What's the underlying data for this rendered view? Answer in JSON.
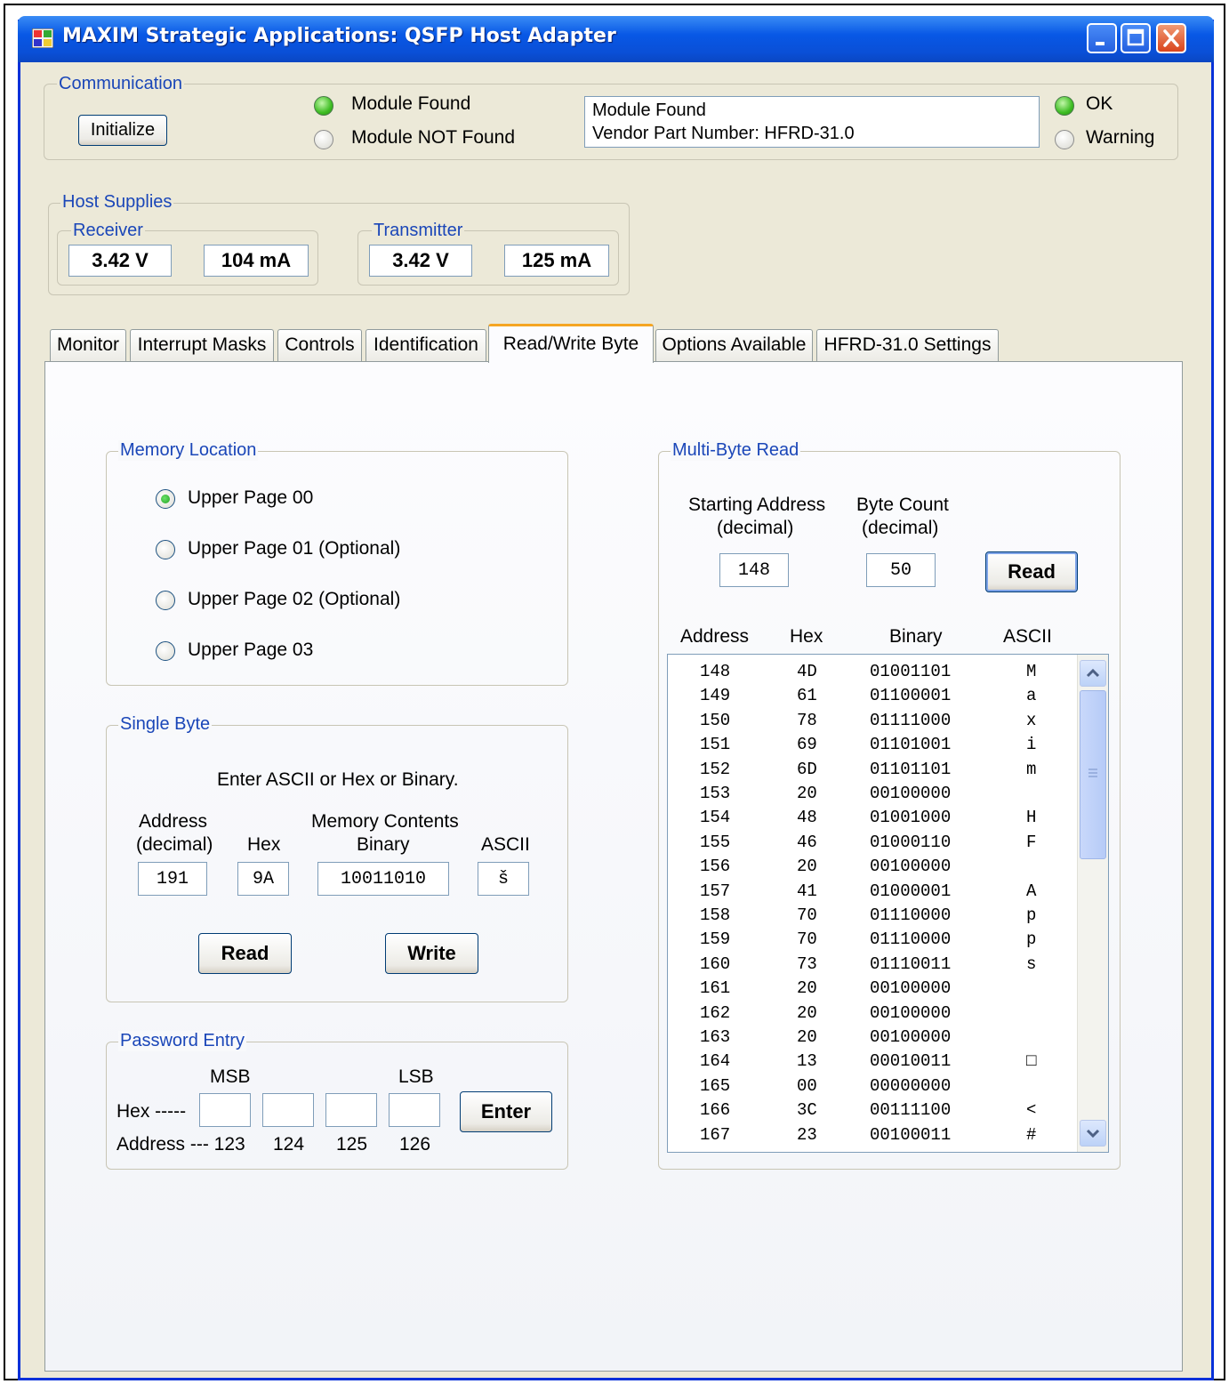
{
  "window": {
    "title": "MAXIM Strategic Applications: QSFP Host Adapter"
  },
  "communication": {
    "legend": "Communication",
    "initialize_label": "Initialize",
    "module_found_label": "Module Found",
    "module_not_found_label": "Module NOT Found",
    "status_line1": "Module Found",
    "status_line2": "Vendor Part Number: HFRD-31.0",
    "ok_label": "OK",
    "warning_label": "Warning"
  },
  "host_supplies": {
    "legend": "Host Supplies",
    "receiver": {
      "legend": "Receiver",
      "voltage": "3.42 V",
      "current": "104 mA"
    },
    "transmitter": {
      "legend": "Transmitter",
      "voltage": "3.42 V",
      "current": "125 mA"
    }
  },
  "tabs": [
    {
      "label": "Monitor"
    },
    {
      "label": "Interrupt Masks"
    },
    {
      "label": "Controls"
    },
    {
      "label": "Identification"
    },
    {
      "label": "Read/Write Byte"
    },
    {
      "label": "Options Available"
    },
    {
      "label": "HFRD-31.0 Settings"
    }
  ],
  "memory_location": {
    "legend": "Memory Location",
    "options": [
      "Upper Page 00",
      "Upper Page 01 (Optional)",
      "Upper Page 02 (Optional)",
      "Upper Page 03"
    ],
    "selected": "Upper Page 00"
  },
  "single_byte": {
    "legend": "Single Byte",
    "instruction": "Enter ASCII or Hex or Binary.",
    "address_label1": "Address",
    "address_label2": "(decimal)",
    "hex_label": "Hex",
    "memory_contents_label": "Memory Contents",
    "binary_label": "Binary",
    "ascii_label": "ASCII",
    "address_value": "191",
    "hex_value": "9A",
    "binary_value": "10011010",
    "ascii_value": "š",
    "read_label": "Read",
    "write_label": "Write"
  },
  "password": {
    "legend": "Password Entry",
    "msb_label": "MSB",
    "lsb_label": "LSB",
    "hex_label": "Hex -----",
    "address_label": "Address --- 123",
    "addr_124": "124",
    "addr_125": "125",
    "addr_126": "126",
    "enter_label": "Enter"
  },
  "multi_byte": {
    "legend": "Multi-Byte Read",
    "start_label1": "Starting Address",
    "start_label2": "(decimal)",
    "count_label1": "Byte Count",
    "count_label2": "(decimal)",
    "start_value": "148",
    "count_value": "50",
    "read_label": "Read",
    "col_address": "Address",
    "col_hex": "Hex",
    "col_binary": "Binary",
    "col_ascii": "ASCII",
    "rows": [
      [
        "148",
        "4D",
        "01001101",
        "M"
      ],
      [
        "149",
        "61",
        "01100001",
        "a"
      ],
      [
        "150",
        "78",
        "01111000",
        "x"
      ],
      [
        "151",
        "69",
        "01101001",
        "i"
      ],
      [
        "152",
        "6D",
        "01101101",
        "m"
      ],
      [
        "153",
        "20",
        "00100000",
        ""
      ],
      [
        "154",
        "48",
        "01001000",
        "H"
      ],
      [
        "155",
        "46",
        "01000110",
        "F"
      ],
      [
        "156",
        "20",
        "00100000",
        ""
      ],
      [
        "157",
        "41",
        "01000001",
        "A"
      ],
      [
        "158",
        "70",
        "01110000",
        "p"
      ],
      [
        "159",
        "70",
        "01110000",
        "p"
      ],
      [
        "160",
        "73",
        "01110011",
        "s"
      ],
      [
        "161",
        "20",
        "00100000",
        ""
      ],
      [
        "162",
        "20",
        "00100000",
        ""
      ],
      [
        "163",
        "20",
        "00100000",
        ""
      ],
      [
        "164",
        "13",
        "00010011",
        "□"
      ],
      [
        "165",
        "00",
        "00000000",
        ""
      ],
      [
        "166",
        "3C",
        "00111100",
        "<"
      ],
      [
        "167",
        "23",
        "00100011",
        "#"
      ]
    ]
  },
  "colors": {
    "titlebar": "#0a4fd6",
    "window_bg": "#ece9d8",
    "legend_text": "#1a46b8",
    "active_tab_accent": "#f5a623"
  }
}
